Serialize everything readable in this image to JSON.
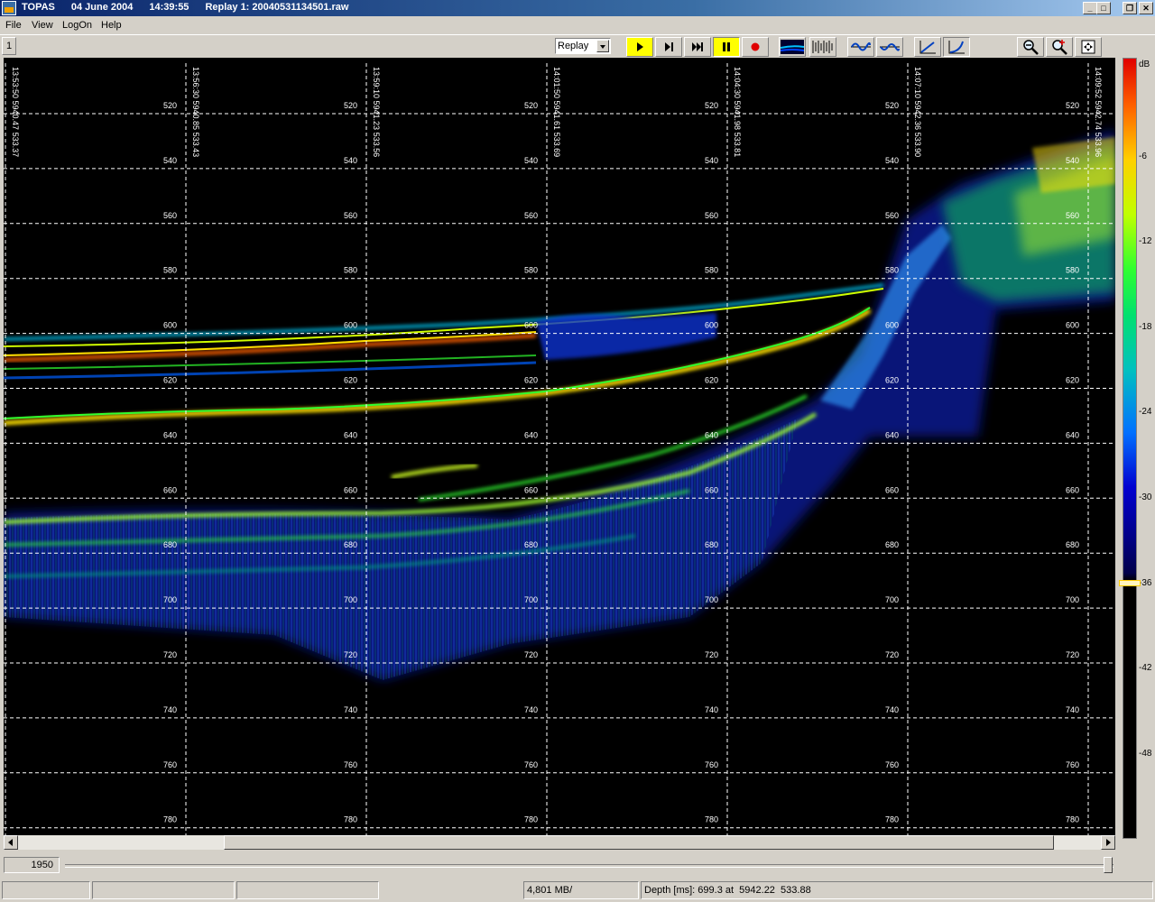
{
  "window": {
    "app": "TOPAS",
    "date": "04 June 2004",
    "time": "14:39:55",
    "replay": "Replay 1: 20040531134501.raw"
  },
  "menu": [
    "File",
    "View",
    "LogOn",
    "Help"
  ],
  "toolbar": {
    "tab_label": "1",
    "mode_select": "Replay",
    "icons": [
      "play-icon",
      "step-icon",
      "fast-forward-icon",
      "pause-icon",
      "record-icon",
      "echogram-view-icon",
      "waveform-view-icon",
      "signal-icon",
      "signal-alt-icon",
      "gain-curve-icon",
      "gain-curve-alt-icon",
      "zoom-out-icon",
      "zoom-in-icon",
      "fit-view-icon"
    ]
  },
  "echogram": {
    "depth_ticks": [
      520,
      540,
      560,
      580,
      600,
      620,
      640,
      660,
      680,
      700,
      720,
      740,
      760,
      780
    ],
    "time_markers": [
      {
        "time": "13:53:50",
        "coord1": "5940.47",
        "coord2": "533.37"
      },
      {
        "time": "13:56:30",
        "coord1": "5940.85",
        "coord2": "533.43"
      },
      {
        "time": "13:59:10",
        "coord1": "5941.23",
        "coord2": "533.56"
      },
      {
        "time": "14:01:50",
        "coord1": "5941.61",
        "coord2": "533.69"
      },
      {
        "time": "14:04:30",
        "coord1": "5941.98",
        "coord2": "533.81"
      },
      {
        "time": "14:07:10",
        "coord1": "5942.36",
        "coord2": "533.90"
      },
      {
        "time": "14:09:52",
        "coord1": "5942.74",
        "coord2": "533.96"
      }
    ]
  },
  "colorbar": {
    "unit": "dB",
    "labels": [
      "-6",
      "-12",
      "-18",
      "-24",
      "-30",
      "-36",
      "-42",
      "-48"
    ],
    "threshold": -36
  },
  "position": {
    "value": "1950"
  },
  "status": {
    "panel1": "",
    "panel2": "",
    "panel3": "",
    "memory": "4,801 MB/",
    "depth": "Depth [ms]: 699.3 at  5942.22  533.88"
  }
}
